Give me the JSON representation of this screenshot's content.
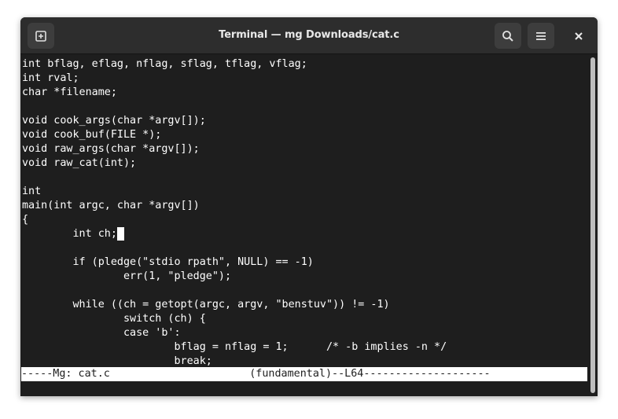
{
  "window": {
    "title": "Terminal — mg Downloads/cat.c"
  },
  "header": {
    "new_tab_icon": "new-tab-icon",
    "search_icon": "search-icon",
    "menu_icon": "hamburger-menu-icon",
    "close_icon": "close-icon"
  },
  "terminal": {
    "lines": [
      "int bflag, eflag, nflag, sflag, tflag, vflag;",
      "int rval;",
      "char *filename;",
      "",
      "void cook_args(char *argv[]);",
      "void cook_buf(FILE *);",
      "void raw_args(char *argv[]);",
      "void raw_cat(int);",
      "",
      "int",
      "main(int argc, char *argv[])",
      "{",
      "        int ch;",
      "",
      "        if (pledge(\"stdio rpath\", NULL) == -1)",
      "                err(1, \"pledge\");",
      "",
      "        while ((ch = getopt(argc, argv, \"benstuv\")) != -1)",
      "                switch (ch) {",
      "                case 'b':",
      "                        bflag = nflag = 1;      /* -b implies -n */",
      "                        break;"
    ],
    "cursor_line": 12,
    "modeline": "-----Mg: cat.c                      (fundamental)--L64--------------------"
  },
  "colors": {
    "background": "#1e1e1e",
    "titlebar": "#2d2d2d",
    "text": "#ffffff",
    "modeline_bg": "#ffffff"
  }
}
